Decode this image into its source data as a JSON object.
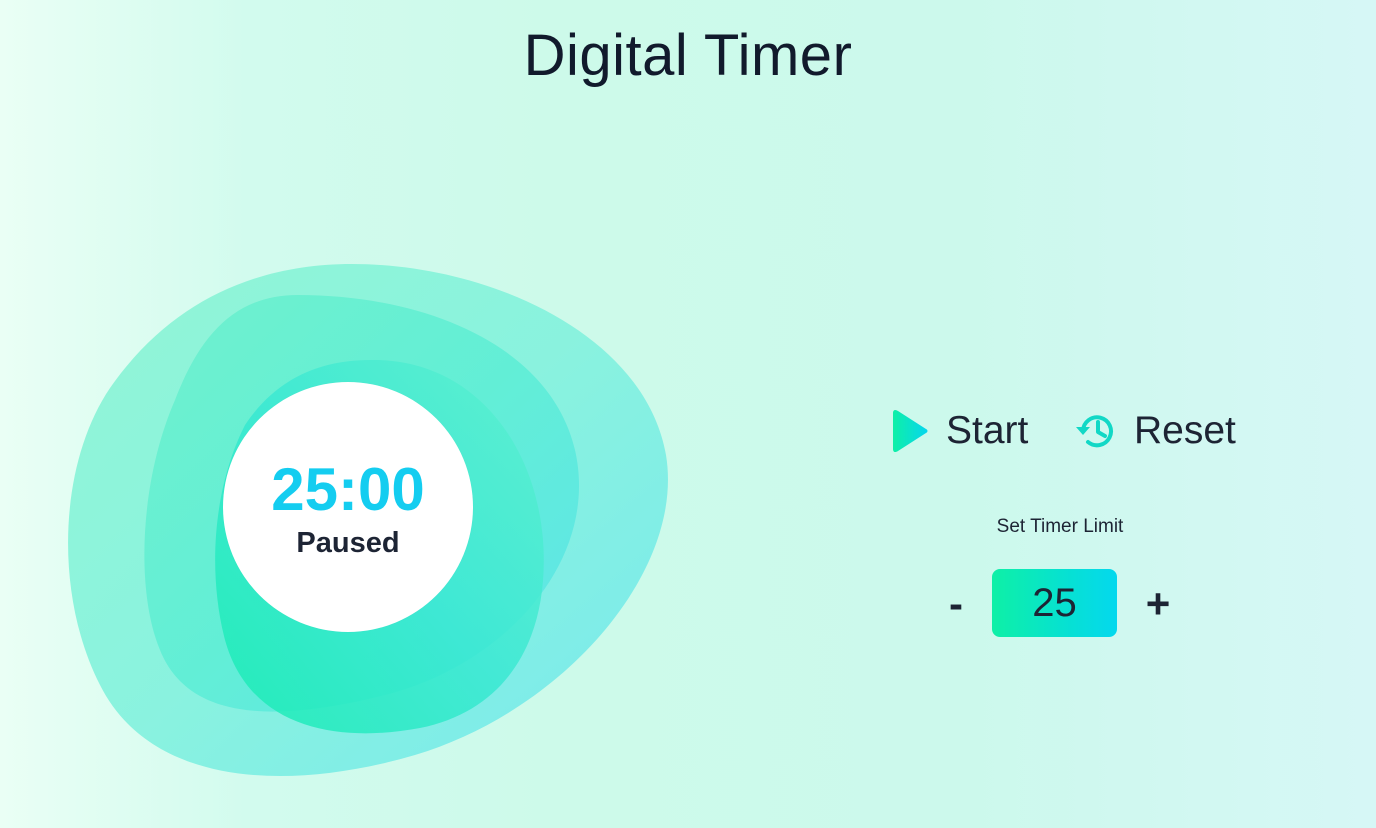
{
  "app": {
    "title": "Digital Timer"
  },
  "timer": {
    "time": "25:00",
    "status": "Paused"
  },
  "controls": {
    "start_label": "Start",
    "start_icon": "play-icon",
    "reset_label": "Reset",
    "reset_icon": "reset-history-icon"
  },
  "limit": {
    "caption": "Set Timer Limit",
    "decrement_label": "-",
    "value": "25",
    "increment_label": "+"
  },
  "colors": {
    "accent_cyan": "#14cdf0",
    "accent_green": "#0ef0a6",
    "text_dark": "#1d2434",
    "background": "#cdfaea"
  }
}
